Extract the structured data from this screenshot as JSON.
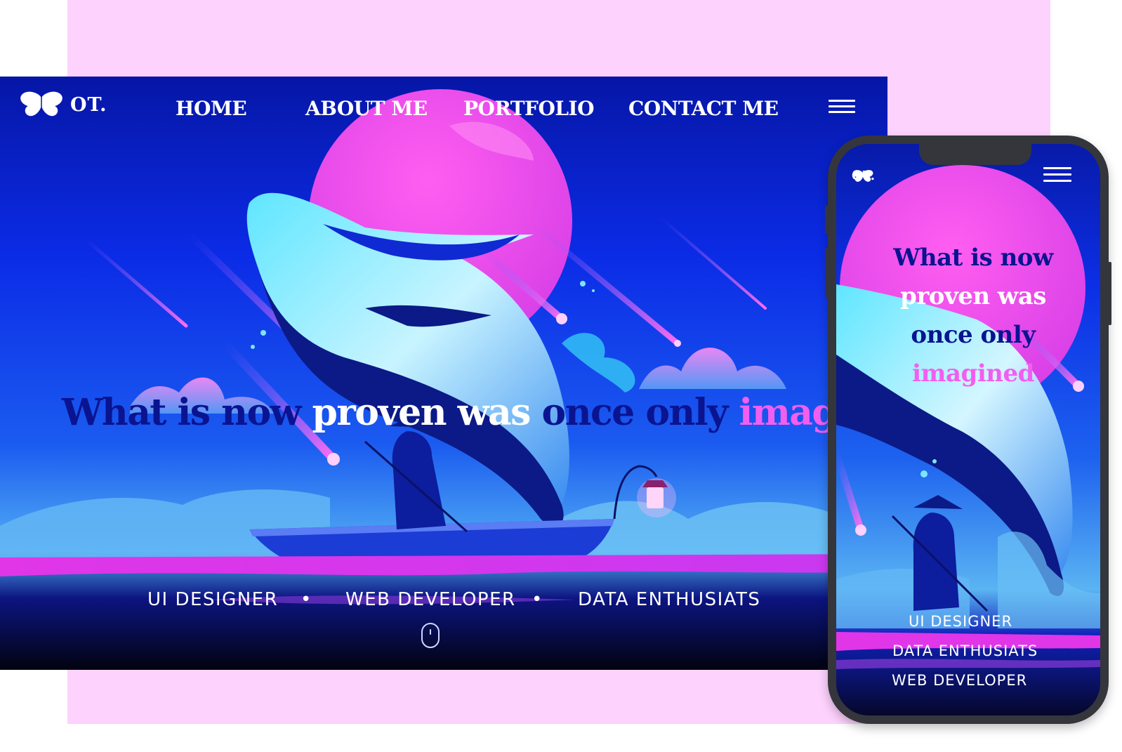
{
  "desktop": {
    "logo_text": "OT.",
    "nav": {
      "home": "HOME",
      "about": "ABOUT ME",
      "portfolio": "PORTFOLIO",
      "contact": "CONTACT ME"
    },
    "headline": {
      "part1": "What is now",
      "part2": "proven was",
      "part3": "once only",
      "part4": "imagined"
    },
    "roles": {
      "role1": "UI DESIGNER",
      "role2": "WEB DEVELOPER",
      "role3": "DATA ENTHUSIATS",
      "separator": "•"
    }
  },
  "phone": {
    "logo_text": "OT.",
    "headline": {
      "line1": "What is now",
      "line2": "proven was",
      "line3": "once only",
      "line4": "imagined"
    },
    "roles": {
      "role1": "UI DESIGNER",
      "role2": "DATA ENTHUSIATS",
      "role3": "WEB DEVELOPER"
    }
  },
  "colors": {
    "panel_pink": "#fdd2fd",
    "headline_dark": "#0a1490",
    "headline_accent": "#f25ef0",
    "phone_frame": "#34363c"
  },
  "icons": [
    "butterfly-icon",
    "hamburger-menu-icon",
    "mouse-scroll-icon"
  ]
}
